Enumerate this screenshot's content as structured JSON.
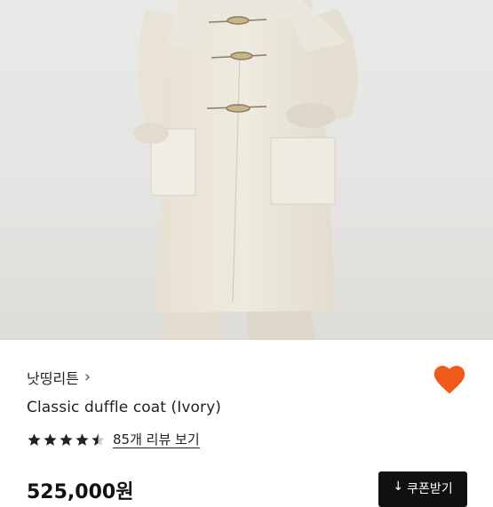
{
  "product": {
    "brand": "낫띵리튼",
    "title": "Classic duffle coat (Ivory)",
    "rating": 4.5,
    "reviews_label": "85개 리뷰 보기",
    "price": "525,000원",
    "coupon_label": "쿠폰받기"
  },
  "icons": {
    "brand_chevron": "chevron-right-icon",
    "favorite": "heart-icon",
    "coupon": "download-arrow-icon"
  },
  "colors": {
    "heart": "#f05a1a",
    "coupon_bg": "#111111",
    "text": "#222222"
  }
}
